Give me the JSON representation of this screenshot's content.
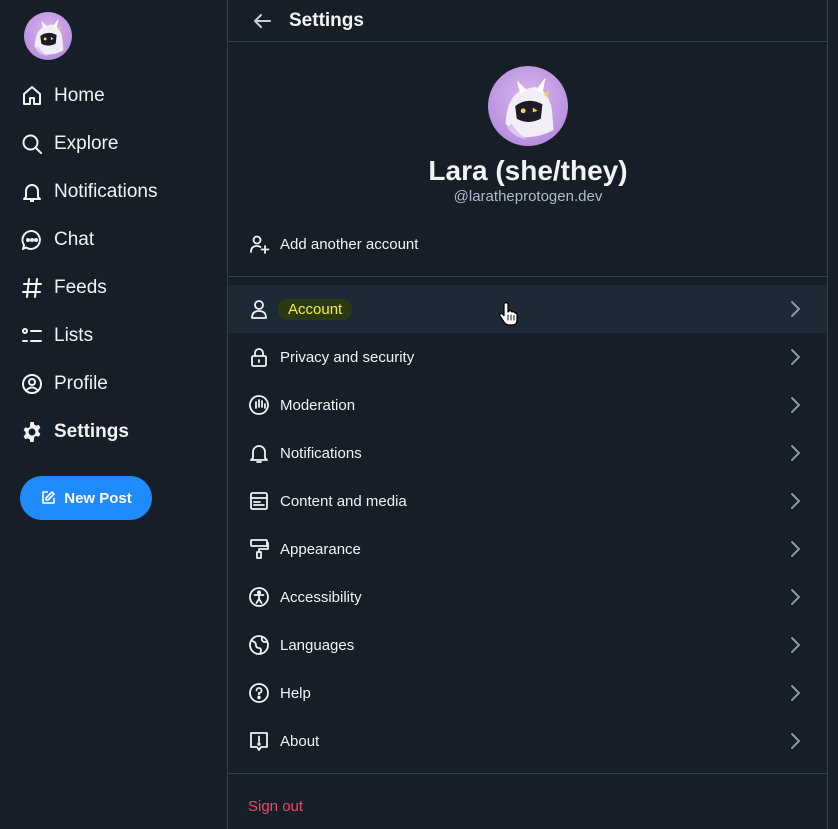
{
  "sidebar": {
    "avatar_alt": "avatar",
    "items": [
      {
        "label": "Home",
        "icon": "home-icon"
      },
      {
        "label": "Explore",
        "icon": "search-icon"
      },
      {
        "label": "Notifications",
        "icon": "bell-icon"
      },
      {
        "label": "Chat",
        "icon": "chat-icon"
      },
      {
        "label": "Feeds",
        "icon": "hash-icon"
      },
      {
        "label": "Lists",
        "icon": "list-icon"
      },
      {
        "label": "Profile",
        "icon": "user-circle-icon"
      },
      {
        "label": "Settings",
        "icon": "gear-icon"
      }
    ],
    "active": "Settings",
    "new_post_label": "New Post"
  },
  "header": {
    "title": "Settings"
  },
  "profile": {
    "name": "Lara (she/they)",
    "handle": "@laratheprotogen.dev"
  },
  "add_account_label": "Add another account",
  "settings_rows": [
    {
      "label": "Account",
      "icon": "person-icon",
      "hovered": true
    },
    {
      "label": "Privacy and security",
      "icon": "lock-icon"
    },
    {
      "label": "Moderation",
      "icon": "hand-icon"
    },
    {
      "label": "Notifications",
      "icon": "bell-icon"
    },
    {
      "label": "Content and media",
      "icon": "window-icon"
    },
    {
      "label": "Appearance",
      "icon": "paint-roller-icon"
    },
    {
      "label": "Accessibility",
      "icon": "accessibility-icon"
    },
    {
      "label": "Languages",
      "icon": "globe-icon"
    },
    {
      "label": "Help",
      "icon": "help-circle-icon"
    },
    {
      "label": "About",
      "icon": "info-bubble-icon"
    }
  ],
  "signout_label": "Sign out",
  "colors": {
    "background": "#161e27",
    "accent": "#208bfe",
    "signout": "#ec4868",
    "highlight_text": "#f4ef39"
  }
}
